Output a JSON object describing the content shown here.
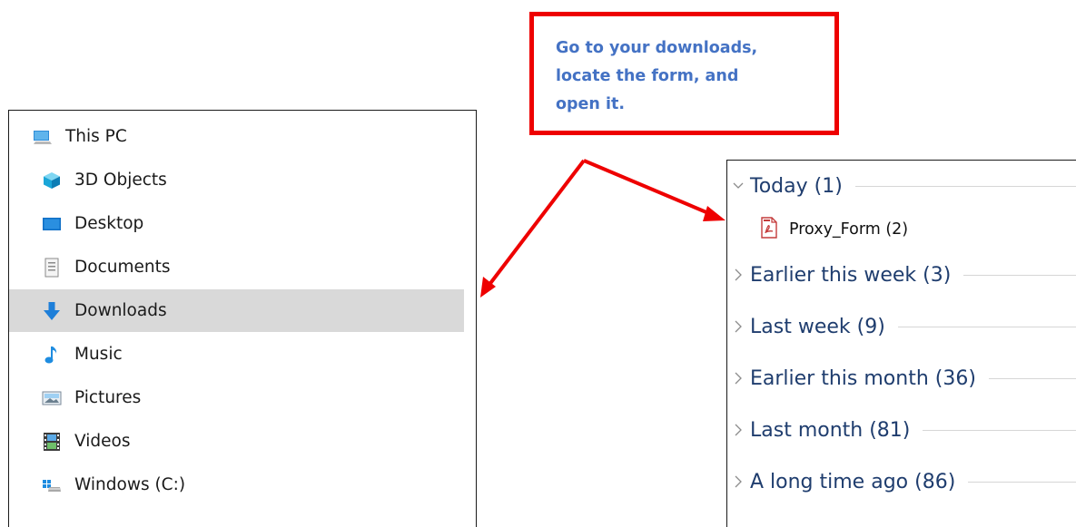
{
  "callout": {
    "lines": [
      "Go to your downloads,",
      "locate the form, and",
      "open it."
    ]
  },
  "nav": {
    "items": [
      {
        "label": "This PC",
        "icon": "this-pc-icon"
      },
      {
        "label": "3D Objects",
        "icon": "3d-objects-icon"
      },
      {
        "label": "Desktop",
        "icon": "desktop-icon"
      },
      {
        "label": "Documents",
        "icon": "documents-icon"
      },
      {
        "label": "Downloads",
        "icon": "downloads-icon",
        "selected": true
      },
      {
        "label": "Music",
        "icon": "music-icon"
      },
      {
        "label": "Pictures",
        "icon": "pictures-icon"
      },
      {
        "label": "Videos",
        "icon": "videos-icon"
      },
      {
        "label": "Windows  (C:)",
        "icon": "windows-drive-icon"
      }
    ]
  },
  "downloads": {
    "groups": [
      {
        "label": "Today (1)",
        "expanded": true
      },
      {
        "label": "Earlier this week (3)",
        "expanded": false
      },
      {
        "label": "Last week (9)",
        "expanded": false
      },
      {
        "label": "Earlier this month (36)",
        "expanded": false
      },
      {
        "label": "Last month (81)",
        "expanded": false
      },
      {
        "label": "A long time ago (86)",
        "expanded": false
      }
    ],
    "file": {
      "label": "Proxy_Form (2)",
      "icon": "pdf-file-icon"
    }
  },
  "colors": {
    "callout_border": "#ee0000",
    "callout_text": "#4472c4",
    "arrow": "#ee0000",
    "selected_row": "#d9d9d9",
    "group_heading": "#1f3d6e"
  }
}
